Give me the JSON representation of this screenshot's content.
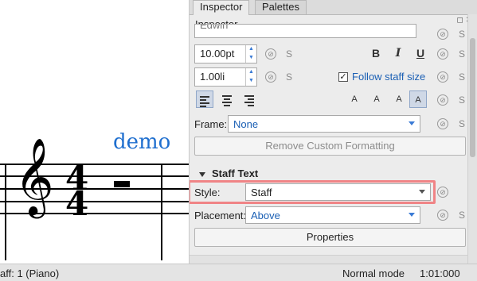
{
  "score": {
    "text": "demo",
    "clef": "treble-clef",
    "time_signature": {
      "top": "4",
      "bottom": "4"
    },
    "rest": "whole-rest"
  },
  "status": {
    "left": "aff: 1 (Piano)",
    "mode": "Normal mode",
    "position": "1:01:000"
  },
  "inspector": {
    "tabs": [
      "Inspector",
      "Palettes"
    ],
    "title": "Inspector",
    "font_name": "Edwin",
    "font_size": "10.00pt",
    "spacing": "1.00li",
    "style_marker": "S",
    "bold": "B",
    "italic": "I",
    "underline": "U",
    "follow_staff_size": {
      "label": "Follow staff size",
      "checked": true
    },
    "script_buttons": [
      "A",
      "A",
      "A",
      "A"
    ],
    "frame": {
      "label": "Frame:",
      "value": "None"
    },
    "remove_formatting": "Remove Custom Formatting",
    "section": "Staff Text",
    "style": {
      "label": "Style:",
      "value": "Staff"
    },
    "placement": {
      "label": "Placement:",
      "value": "Above"
    },
    "properties": "Properties"
  },
  "colors": {
    "accent": "#1a5fb4",
    "highlight": "#f08486",
    "score_text": "#1f6fcf"
  }
}
